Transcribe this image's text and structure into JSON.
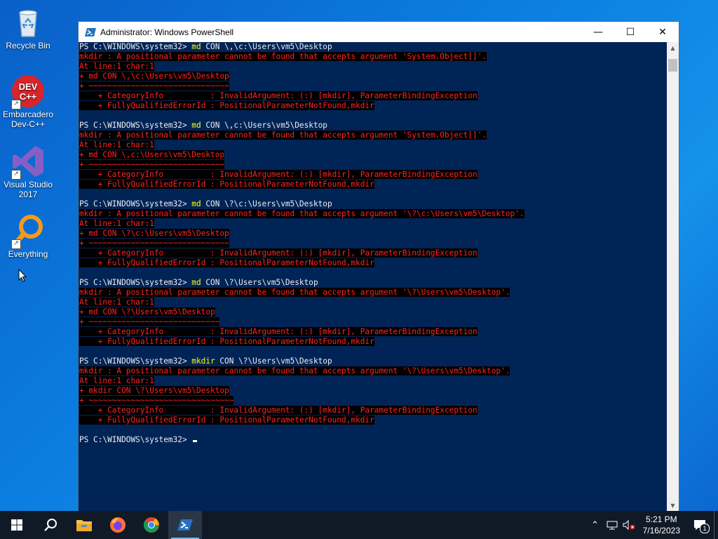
{
  "desktop": {
    "icons": [
      {
        "label": "Recycle Bin"
      },
      {
        "label": "Embarcadero Dev-C++",
        "art_text": "DEV C++"
      },
      {
        "label": "Visual Studio 2017"
      },
      {
        "label": "Everything"
      }
    ]
  },
  "window": {
    "title": "Administrator: Windows PowerShell",
    "controls": {
      "minimize": "—",
      "maximize": "☐",
      "close": "✕"
    }
  },
  "console": {
    "blocks": [
      {
        "prompt": "PS C:\\WINDOWS\\system32> ",
        "command": "md",
        "args": " CON \\,\\c:\\Users\\vm5\\Desktop",
        "errors": [
          "mkdir : A positional parameter cannot be found that accepts argument 'System.Object[]'.",
          "At line:1 char:1",
          "+ md CON \\,\\c:\\Users\\vm5\\Desktop",
          "+ ~~~~~~~~~~~~~~~~~~~~~~~~~~~~~~",
          "    + CategoryInfo          : InvalidArgument: (:) [mkdir], ParameterBindingException",
          "    + FullyQualifiedErrorId : PositionalParameterNotFound,mkdir",
          ""
        ]
      },
      {
        "prompt": "PS C:\\WINDOWS\\system32> ",
        "command": "md",
        "args": " CON \\,c:\\Users\\vm5\\Desktop",
        "errors": [
          "mkdir : A positional parameter cannot be found that accepts argument 'System.Object[]'.",
          "At line:1 char:1",
          "+ md CON \\,c:\\Users\\vm5\\Desktop",
          "+ ~~~~~~~~~~~~~~~~~~~~~~~~~~~~~",
          "    + CategoryInfo          : InvalidArgument: (:) [mkdir], ParameterBindingException",
          "    + FullyQualifiedErrorId : PositionalParameterNotFound,mkdir",
          ""
        ]
      },
      {
        "prompt": "PS C:\\WINDOWS\\system32> ",
        "command": "md",
        "args": " CON \\?\\c:\\Users\\vm5\\Desktop",
        "errors": [
          "mkdir : A positional parameter cannot be found that accepts argument '\\?\\c:\\Users\\vm5\\Desktop'.",
          "At line:1 char:1",
          "+ md CON \\?\\c:\\Users\\vm5\\Desktop",
          "+ ~~~~~~~~~~~~~~~~~~~~~~~~~~~~~~",
          "    + CategoryInfo          : InvalidArgument: (:) [mkdir], ParameterBindingException",
          "    + FullyQualifiedErrorId : PositionalParameterNotFound,mkdir",
          ""
        ]
      },
      {
        "prompt": "PS C:\\WINDOWS\\system32> ",
        "command": "md",
        "args": " CON \\?\\Users\\vm5\\Desktop",
        "errors": [
          "mkdir : A positional parameter cannot be found that accepts argument '\\?\\Users\\vm5\\Desktop'.",
          "At line:1 char:1",
          "+ md CON \\?\\Users\\vm5\\Desktop",
          "+ ~~~~~~~~~~~~~~~~~~~~~~~~~~~~",
          "    + CategoryInfo          : InvalidArgument: (:) [mkdir], ParameterBindingException",
          "    + FullyQualifiedErrorId : PositionalParameterNotFound,mkdir",
          ""
        ]
      },
      {
        "prompt": "PS C:\\WINDOWS\\system32> ",
        "command": "mkdir",
        "args": " CON \\?\\Users\\vm5\\Desktop",
        "errors": [
          "mkdir : A positional parameter cannot be found that accepts argument '\\?\\Users\\vm5\\Desktop'.",
          "At line:1 char:1",
          "+ mkdir CON \\?\\Users\\vm5\\Desktop",
          "+ ~~~~~~~~~~~~~~~~~~~~~~~~~~~~~~~",
          "    + CategoryInfo          : InvalidArgument: (:) [mkdir], ParameterBindingException",
          "    + FullyQualifiedErrorId : PositionalParameterNotFound,mkdir",
          ""
        ]
      }
    ],
    "final_prompt": "PS C:\\WINDOWS\\system32> "
  },
  "taskbar": {
    "items": [
      "start-icon",
      "search-icon",
      "file-explorer-icon",
      "firefox-icon",
      "chrome-icon",
      "powershell-icon"
    ],
    "active": "powershell-icon",
    "clock_time": "5:21 PM",
    "clock_date": "7/16/2023",
    "notification_count": "1",
    "colors": {
      "taskbar": "#101a27",
      "console_bg": "#012456",
      "error_fg": "#ff2222"
    }
  }
}
